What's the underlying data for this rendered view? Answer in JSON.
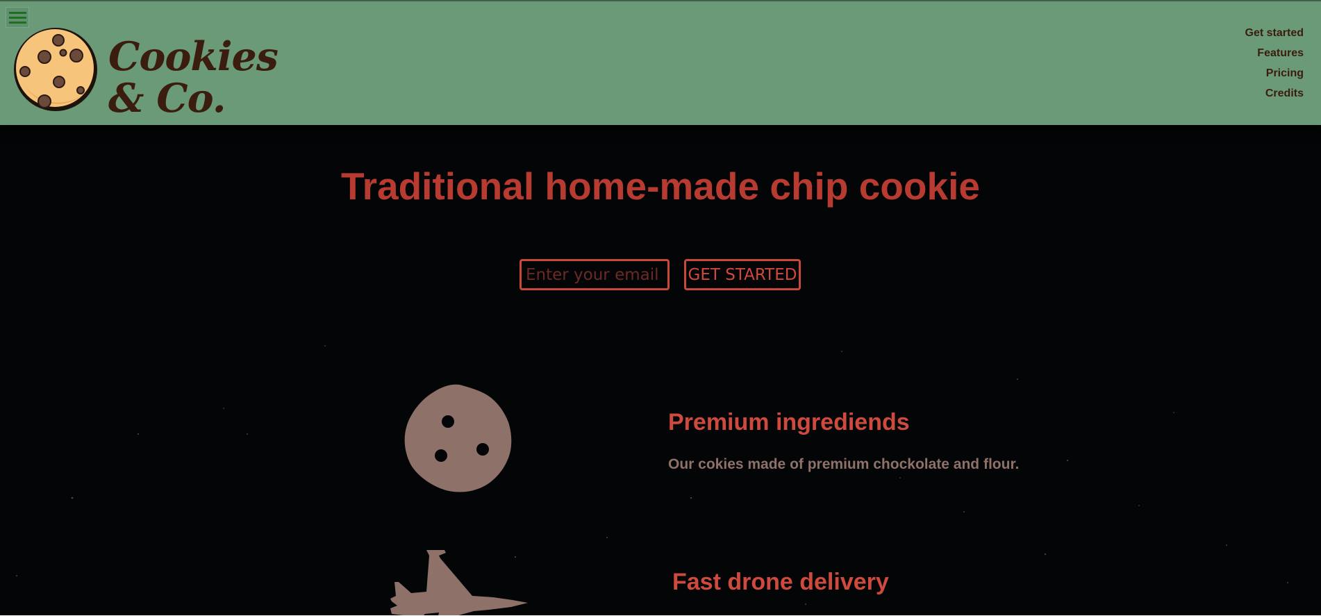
{
  "brand": {
    "logo_text": "Cookies\n& Co."
  },
  "nav": {
    "items": [
      {
        "label": "Get started"
      },
      {
        "label": "Features"
      },
      {
        "label": "Pricing"
      },
      {
        "label": "Credits"
      }
    ]
  },
  "hero": {
    "title": "Traditional home-made chip cookie",
    "email_placeholder": "Enter your email",
    "cta_label": "GET STARTED"
  },
  "features": [
    {
      "icon": "cookie-icon",
      "title": "Premium ingrediends",
      "description": "Our cokies made of premium chockolate and flour."
    },
    {
      "icon": "jet-icon",
      "title": "Fast drone delivery"
    }
  ],
  "colors": {
    "header_bg": "#6a9a78",
    "page_bg": "#040506",
    "accent": "#cf4a3e",
    "brown_text": "#3b1d0f",
    "muted_text": "#8e7168"
  }
}
